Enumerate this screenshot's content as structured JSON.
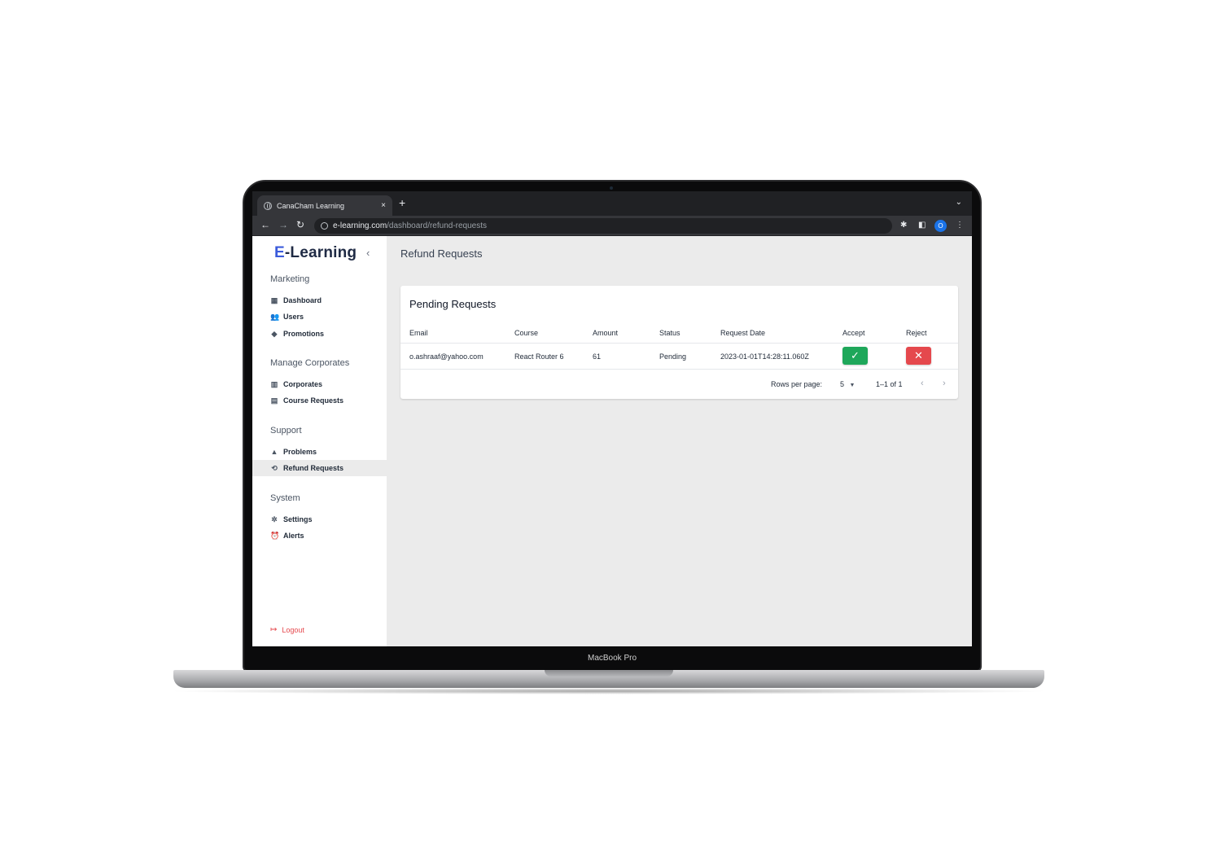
{
  "device": {
    "label": "MacBook Pro"
  },
  "browser": {
    "tab_title": "CanaCham Learning",
    "tab_close": "×",
    "new_tab": "+",
    "tab_menu": "⌄",
    "back": "←",
    "forward": "→",
    "reload": "↻",
    "url_host": "e-learning.com",
    "url_path": "/dashboard/refund-requests",
    "profile_initial": "O",
    "menu": "⋮"
  },
  "sidebar": {
    "logo_first": "E",
    "logo_rest": "-Learning",
    "collapse_icon": "‹",
    "sections": [
      {
        "title": "Marketing",
        "items": [
          "Dashboard",
          "Users",
          "Promotions"
        ]
      },
      {
        "title": "Manage Corporates",
        "items": [
          "Corporates",
          "Course Requests"
        ]
      },
      {
        "title": "Support",
        "items": [
          "Problems",
          "Refund Requests"
        ]
      },
      {
        "title": "System",
        "items": [
          "Settings",
          "Alerts"
        ]
      }
    ],
    "active_item": "Refund Requests",
    "logout": "Logout"
  },
  "main": {
    "page_title": "Refund Requests",
    "card_title": "Pending Requests",
    "columns": [
      "Email",
      "Course",
      "Amount",
      "Status",
      "Request Date",
      "Accept",
      "Reject"
    ],
    "rows": [
      {
        "email": "o.ashraaf@yahoo.com",
        "course": "React Router 6",
        "amount": "61",
        "status": "Pending",
        "request_date": "2023-01-01T14:28:11.060Z"
      }
    ],
    "accept_icon": "✓",
    "reject_icon": "✕",
    "pagination": {
      "rows_per_page_label": "Rows per page:",
      "rows_per_page": "5",
      "range": "1–1 of 1",
      "prev": "‹",
      "next": "›"
    }
  },
  "colors": {
    "accent": "#3b5bdb",
    "accept": "#1ea75a",
    "reject": "#e5484d"
  }
}
